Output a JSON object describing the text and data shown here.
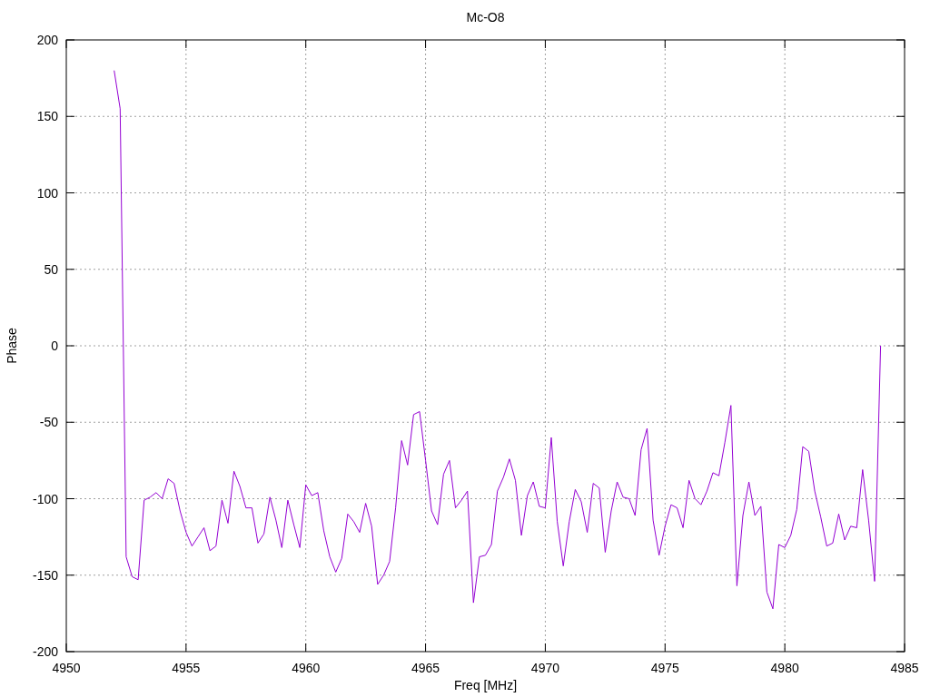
{
  "chart_data": {
    "type": "line",
    "title": "Mc-O8",
    "xlabel": "Freq [MHz]",
    "ylabel": "Phase",
    "x": [
      4952,
      4952.25,
      4952.5,
      4952.75,
      4953,
      4953.25,
      4953.5,
      4953.75,
      4954,
      4954.25,
      4954.5,
      4954.75,
      4955,
      4955.25,
      4955.5,
      4955.75,
      4956,
      4956.25,
      4956.5,
      4956.75,
      4957,
      4957.25,
      4957.5,
      4957.75,
      4958,
      4958.25,
      4958.5,
      4958.75,
      4959,
      4959.25,
      4959.5,
      4959.75,
      4960,
      4960.25,
      4960.5,
      4960.75,
      4961,
      4961.25,
      4961.5,
      4961.75,
      4962,
      4962.25,
      4962.5,
      4962.75,
      4963,
      4963.25,
      4963.5,
      4963.75,
      4964,
      4964.25,
      4964.5,
      4964.75,
      4965,
      4965.25,
      4965.5,
      4965.75,
      4966,
      4966.25,
      4966.5,
      4966.75,
      4967,
      4967.25,
      4967.5,
      4967.75,
      4968,
      4968.25,
      4968.5,
      4968.75,
      4969,
      4969.25,
      4969.5,
      4969.75,
      4970,
      4970.25,
      4970.5,
      4970.75,
      4971,
      4971.25,
      4971.5,
      4971.75,
      4972,
      4972.25,
      4972.5,
      4972.75,
      4973,
      4973.25,
      4973.5,
      4973.75,
      4974,
      4974.25,
      4974.5,
      4974.75,
      4975,
      4975.25,
      4975.5,
      4975.75,
      4976,
      4976.25,
      4976.5,
      4976.75,
      4977,
      4977.25,
      4977.5,
      4977.75,
      4978,
      4978.25,
      4978.5,
      4978.75,
      4979,
      4979.25,
      4979.5,
      4979.75,
      4980,
      4980.25,
      4980.5,
      4980.75,
      4981,
      4981.25,
      4981.5,
      4981.75,
      4982,
      4982.25,
      4982.5,
      4982.75,
      4983,
      4983.25,
      4983.5,
      4983.75,
      4984
    ],
    "series": [
      {
        "color": "#9400d3",
        "values": [
          180,
          155,
          -138,
          -151,
          -153,
          -101,
          -99,
          -96,
          -100,
          -87,
          -90,
          -108,
          -122,
          -131,
          -125,
          -119,
          -134,
          -131,
          -101,
          -116,
          -82,
          -92,
          -106,
          -106,
          -129,
          -123,
          -99,
          -114,
          -132,
          -101,
          -117,
          -132,
          -91,
          -98,
          -96,
          -121,
          -138,
          -148,
          -139,
          -110,
          -115,
          -122,
          -103,
          -118,
          -156,
          -150,
          -141,
          -106,
          -62,
          -78,
          -45,
          -43,
          -75,
          -108,
          -117,
          -84,
          -75,
          -106,
          -101,
          -95,
          -168,
          -138,
          -137,
          -130,
          -95,
          -86,
          -74,
          -88,
          -124,
          -98,
          -89,
          -105,
          -106,
          -60,
          -115,
          -144,
          -115,
          -94,
          -102,
          -122,
          -90,
          -93,
          -135,
          -108,
          -89,
          -99,
          -100,
          -111,
          -68,
          -54,
          -114,
          -137,
          -118,
          -104,
          -106,
          -119,
          -88,
          -100,
          -104,
          -95,
          -83,
          -85,
          -63,
          -39,
          -157,
          -111,
          -89,
          -111,
          -105,
          -161,
          -172,
          -130,
          -132,
          -124,
          -107,
          -66,
          -69,
          -95,
          -112,
          -131,
          -129,
          -110,
          -127,
          -118,
          -119,
          -81,
          -114,
          -154,
          0
        ]
      }
    ],
    "grid": true,
    "xlim": [
      4950,
      4985
    ],
    "ylim": [
      -200,
      200
    ],
    "xticks": [
      4950,
      4955,
      4960,
      4965,
      4970,
      4975,
      4980,
      4985
    ],
    "yticks": [
      -200,
      -150,
      -100,
      -50,
      0,
      50,
      100,
      150,
      200
    ]
  }
}
